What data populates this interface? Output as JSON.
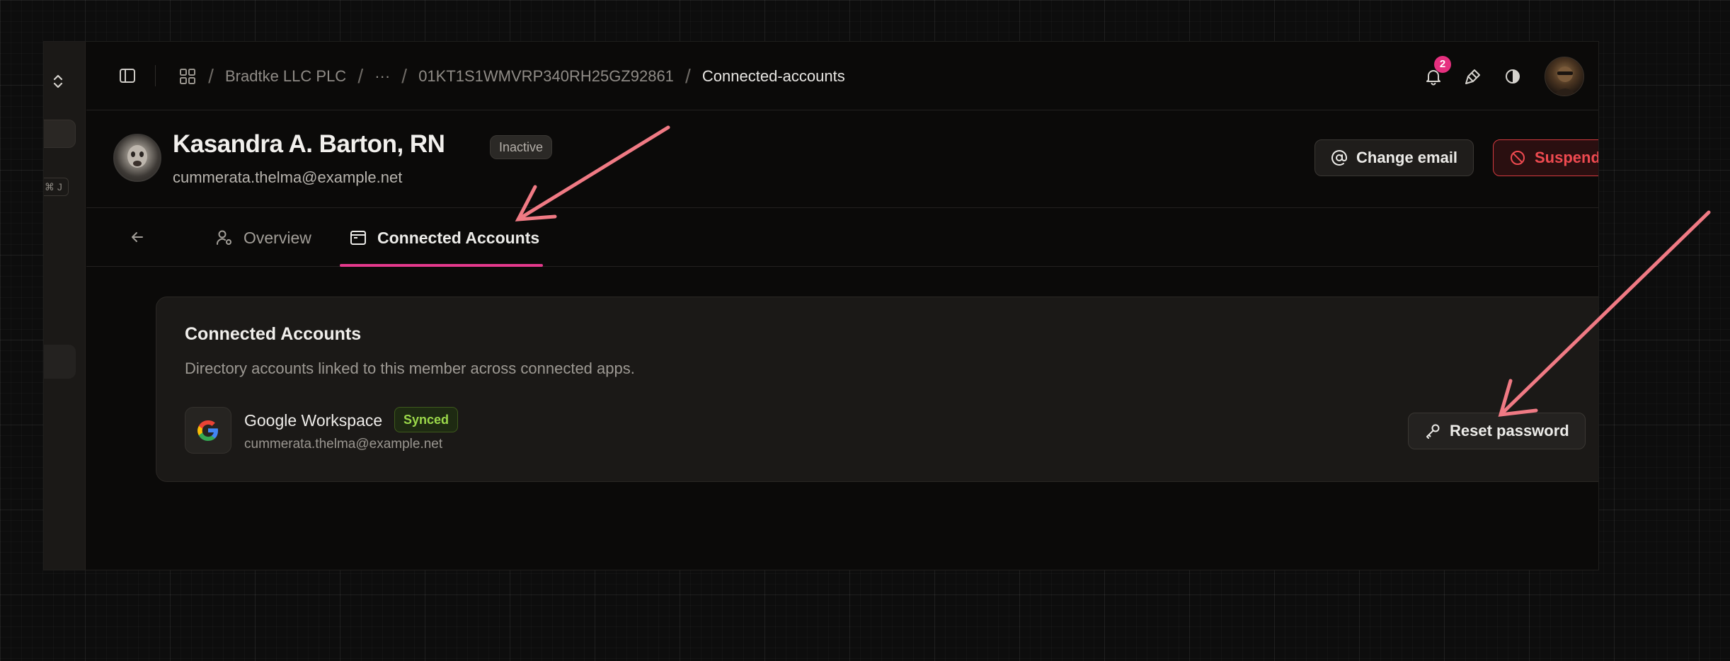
{
  "sidebar": {
    "shortcut_hint": "⌘ J"
  },
  "breadcrumb": {
    "items": [
      "Bradtke LLC PLC",
      "···",
      "01KT1S1WMVRP340RH25GZ92861",
      "Connected-accounts"
    ]
  },
  "notifications": {
    "count": "2"
  },
  "member": {
    "name": "Kasandra A. Barton, RN",
    "status": "Inactive",
    "email": "cummerata.thelma@example.net"
  },
  "actions": {
    "change_email": "Change email",
    "suspend": "Suspend"
  },
  "tabs": {
    "overview": "Overview",
    "connected_accounts": "Connected Accounts"
  },
  "card": {
    "title": "Connected Accounts",
    "description": "Directory accounts linked to this member across connected apps.",
    "account": {
      "app_name": "Google Workspace",
      "status": "Synced",
      "email": "cummerata.thelma@example.net",
      "action": "Reset password"
    }
  },
  "colors": {
    "accent": "#e4398c",
    "danger": "#ef4a50",
    "success": "#9bd84a",
    "annotation_arrow": "#f07a84"
  },
  "icons": [
    "chevrons-up-down-icon",
    "sidebar-toggle-icon",
    "grid-icon",
    "bell-icon",
    "brush-icon",
    "contrast-icon",
    "at-sign-icon",
    "ban-icon",
    "arrow-left-icon",
    "user-cog-icon",
    "browser-window-icon",
    "google-icon",
    "key-icon"
  ]
}
